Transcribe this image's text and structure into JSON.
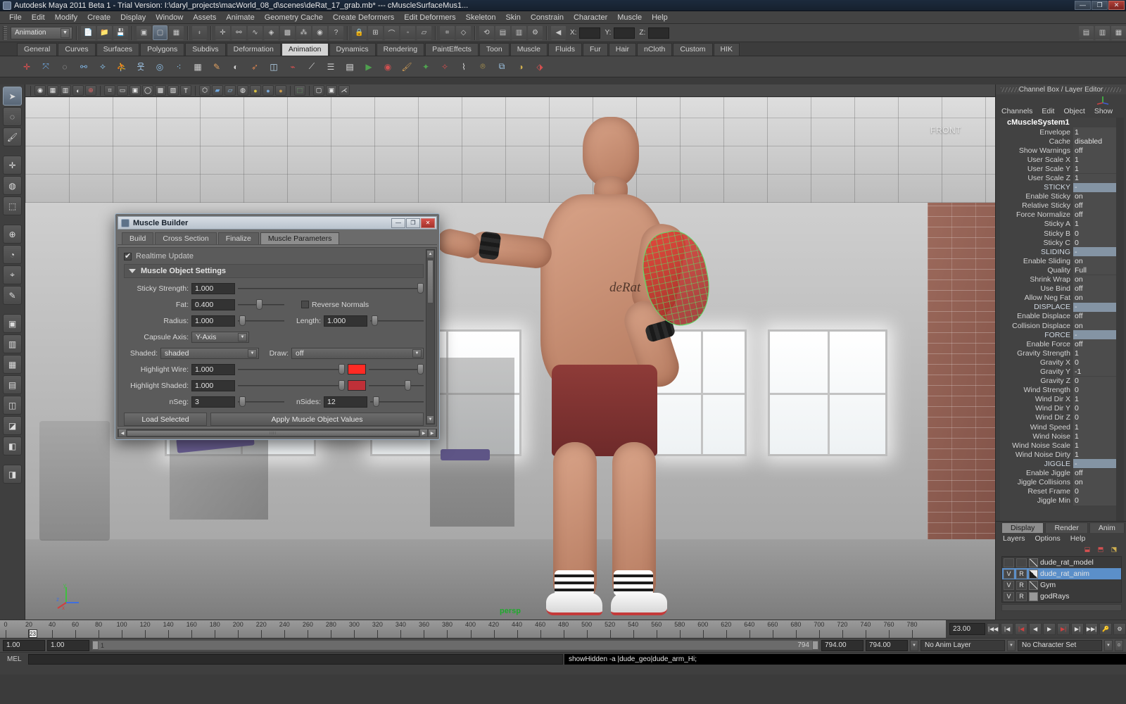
{
  "window": {
    "title": "Autodesk Maya 2011 Beta 1 - Trial Version: I:\\daryl_projects\\macWorld_08_d\\scenes\\deRat_17_grab.mb*   ---   cMuscleSurfaceMus1...",
    "minimize": "—",
    "maximize": "❐",
    "close": "✕"
  },
  "menubar": {
    "items": [
      "File",
      "Edit",
      "Modify",
      "Create",
      "Display",
      "Window",
      "Assets",
      "Animate",
      "Geometry Cache",
      "Create Deformers",
      "Edit Deformers",
      "Skeleton",
      "Skin",
      "Constrain",
      "Character",
      "Muscle",
      "Help"
    ]
  },
  "toolrow": {
    "mode": "Animation",
    "axis_labels": [
      "X:",
      "Y:",
      "Z:"
    ],
    "axis_values": [
      "",
      "",
      ""
    ]
  },
  "shelf_tabs": {
    "items": [
      "General",
      "Curves",
      "Surfaces",
      "Polygons",
      "Subdivs",
      "Deformation",
      "Animation",
      "Dynamics",
      "Rendering",
      "PaintEffects",
      "Toon",
      "Muscle",
      "Fluids",
      "Fur",
      "Hair",
      "nCloth",
      "Custom",
      "HIK"
    ],
    "active": "Animation"
  },
  "viewport": {
    "front_label": "FRONT",
    "persp_label": "persp",
    "axis": {
      "x": "x",
      "y": "y",
      "z": "z"
    }
  },
  "muscle_builder": {
    "title": "Muscle Builder",
    "tabs": [
      "Build",
      "Cross Section",
      "Finalize",
      "Muscle Parameters"
    ],
    "active_tab": "Muscle Parameters",
    "realtime_update_label": "Realtime Update",
    "realtime_update_checked": true,
    "section_title": "Muscle Object Settings",
    "fields": {
      "sticky_strength_label": "Sticky Strength:",
      "sticky_strength_value": "1.000",
      "fat_label": "Fat:",
      "fat_value": "0.400",
      "reverse_normals_label": "Reverse Normals",
      "reverse_normals_checked": false,
      "radius_label": "Radius:",
      "radius_value": "1.000",
      "length_label": "Length:",
      "length_value": "1.000",
      "capsule_axis_label": "Capsule Axis:",
      "capsule_axis_value": "Y-Axis",
      "shaded_label": "Shaded:",
      "shaded_value": "shaded",
      "draw_label": "Draw:",
      "draw_value": "off",
      "highlight_wire_label": "Highlight Wire:",
      "highlight_wire_value": "1.000",
      "highlight_wire_color": "#ff2a24",
      "highlight_shaded_label": "Highlight Shaded:",
      "highlight_shaded_value": "1.000",
      "highlight_shaded_color": "#bf3038",
      "nseg_label": "nSeg:",
      "nseg_value": "3",
      "nsides_label": "nSides:",
      "nsides_value": "12"
    },
    "buttons": {
      "load_selected": "Load Selected",
      "apply": "Apply Muscle Object Values"
    }
  },
  "channel_box": {
    "panel_title": "Channel Box / Layer Editor",
    "menu": [
      "Channels",
      "Edit",
      "Object",
      "Show"
    ],
    "node_name": "cMuscleSystem1",
    "rows": [
      {
        "key": "Envelope",
        "value": "1",
        "header": false
      },
      {
        "key": "Cache",
        "value": "disabled",
        "header": false
      },
      {
        "key": "Show Warnings",
        "value": "off",
        "header": false
      },
      {
        "key": "User Scale X",
        "value": "1",
        "header": false
      },
      {
        "key": "User Scale Y",
        "value": "1",
        "header": false
      },
      {
        "key": "User Scale Z",
        "value": "1",
        "header": false
      },
      {
        "key": "STICKY",
        "value": "-",
        "header": true
      },
      {
        "key": "Enable Sticky",
        "value": "on",
        "header": false
      },
      {
        "key": "Relative Sticky",
        "value": "off",
        "header": false
      },
      {
        "key": "Force Normalize",
        "value": "off",
        "header": false
      },
      {
        "key": "Sticky A",
        "value": "1",
        "header": false
      },
      {
        "key": "Sticky B",
        "value": "0",
        "header": false
      },
      {
        "key": "Sticky C",
        "value": "0",
        "header": false
      },
      {
        "key": "SLIDING",
        "value": "-",
        "header": true
      },
      {
        "key": "Enable Sliding",
        "value": "on",
        "header": false
      },
      {
        "key": "Quality",
        "value": "Full",
        "header": false
      },
      {
        "key": "Shrink Wrap",
        "value": "on",
        "header": false
      },
      {
        "key": "Use Bind",
        "value": "off",
        "header": false
      },
      {
        "key": "Allow Neg Fat",
        "value": "on",
        "header": false
      },
      {
        "key": "DISPLACE",
        "value": "-",
        "header": true
      },
      {
        "key": "Enable Displace",
        "value": "off",
        "header": false
      },
      {
        "key": "Collision Displace",
        "value": "on",
        "header": false
      },
      {
        "key": "FORCE",
        "value": "-",
        "header": true
      },
      {
        "key": "Enable Force",
        "value": "off",
        "header": false
      },
      {
        "key": "Gravity Strength",
        "value": "1",
        "header": false
      },
      {
        "key": "Gravity X",
        "value": "0",
        "header": false
      },
      {
        "key": "Gravity Y",
        "value": "-1",
        "header": false
      },
      {
        "key": "Gravity Z",
        "value": "0",
        "header": false
      },
      {
        "key": "Wind Strength",
        "value": "0",
        "header": false
      },
      {
        "key": "Wind Dir X",
        "value": "1",
        "header": false
      },
      {
        "key": "Wind Dir Y",
        "value": "0",
        "header": false
      },
      {
        "key": "Wind Dir Z",
        "value": "0",
        "header": false
      },
      {
        "key": "Wind Speed",
        "value": "1",
        "header": false
      },
      {
        "key": "Wind Noise",
        "value": "1",
        "header": false
      },
      {
        "key": "Wind Noise Scale",
        "value": "1",
        "header": false
      },
      {
        "key": "Wind Noise Dirty",
        "value": "1",
        "header": false
      },
      {
        "key": "JIGGLE",
        "value": "-",
        "header": true
      },
      {
        "key": "Enable Jiggle",
        "value": "off",
        "header": false
      },
      {
        "key": "Jiggle Collisions",
        "value": "on",
        "header": false
      },
      {
        "key": "Reset Frame",
        "value": "0",
        "header": false
      },
      {
        "key": "Jiggle Min",
        "value": "0",
        "header": false
      }
    ]
  },
  "layer_editor": {
    "tabs": [
      "Display",
      "Render",
      "Anim"
    ],
    "active_tab": "Display",
    "menu": [
      "Layers",
      "Options",
      "Help"
    ],
    "layers": [
      {
        "name": "dude_rat_model",
        "v": "",
        "r": "",
        "selected": false,
        "swatch": "diag"
      },
      {
        "name": "dude_rat_anim",
        "v": "V",
        "r": "R",
        "selected": true,
        "swatch": "half"
      },
      {
        "name": "Gym",
        "v": "V",
        "r": "R",
        "selected": false,
        "swatch": "diag"
      },
      {
        "name": "godRays",
        "v": "V",
        "r": "R",
        "selected": false,
        "swatch": "grey"
      }
    ]
  },
  "timeline": {
    "labels": [
      "0",
      "20",
      "40",
      "60",
      "80",
      "100",
      "120",
      "140",
      "160",
      "180",
      "200",
      "220",
      "240",
      "260",
      "280",
      "300",
      "320",
      "340",
      "360",
      "380",
      "400",
      "420",
      "440",
      "460",
      "480",
      "500",
      "520",
      "540",
      "560",
      "580",
      "600",
      "620",
      "640",
      "660",
      "680",
      "700",
      "720",
      "740",
      "760",
      "780"
    ],
    "current_frame": "23",
    "current_time_field": "23.00",
    "playback_buttons": [
      "|◀◀",
      "|◀",
      "|◀",
      "◀",
      "▶",
      "▶|",
      "▶|",
      "▶▶|"
    ]
  },
  "range_bar": {
    "start": "1.00",
    "end": "1.00",
    "range_label": "1",
    "anim_end": "794",
    "range_end_1": "794.00",
    "range_end_2": "794.00",
    "anim_layer": "No Anim Layer",
    "character_set": "No Character Set"
  },
  "command_line": {
    "mel_label": "MEL",
    "input_value": "",
    "output": "showHidden -a |dude_geo|dude_arm_Hi;"
  }
}
